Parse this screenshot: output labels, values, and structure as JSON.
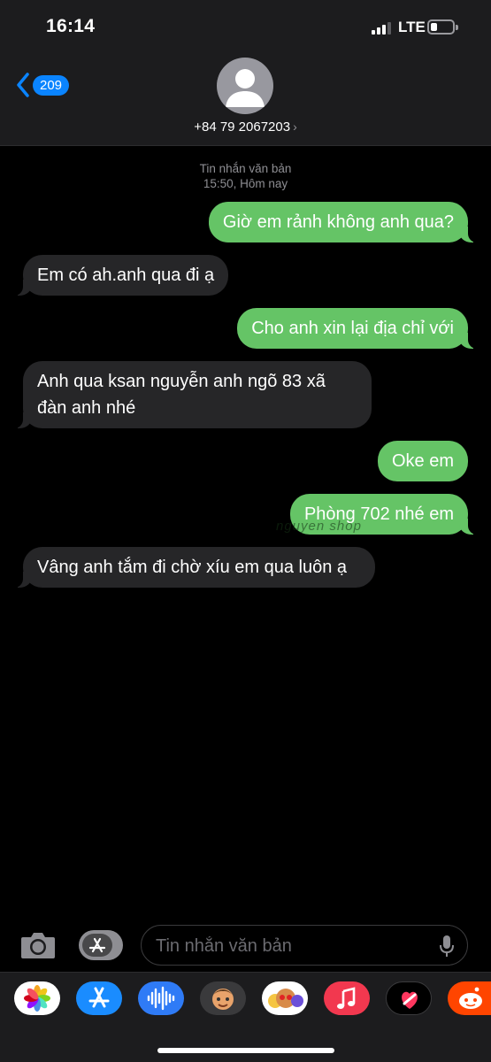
{
  "status_bar": {
    "time": "16:14",
    "network": "LTE"
  },
  "header": {
    "back_badge": "209",
    "contact_name": "+84 79 2067203",
    "contact_chevron": "›"
  },
  "thread": {
    "meta_line1": "Tin nhắn văn bản",
    "meta_line2": "15:50, Hôm nay",
    "messages": [
      {
        "direction": "outgoing",
        "text": "Giờ em rảnh không anh qua?"
      },
      {
        "direction": "incoming",
        "text": "Em có ah.anh qua đi ạ"
      },
      {
        "direction": "outgoing",
        "text": "Cho anh xin lại địa chỉ với"
      },
      {
        "direction": "incoming",
        "text": "Anh qua ksan nguyễn anh ngõ 83 xã đàn anh nhé"
      },
      {
        "direction": "outgoing",
        "text": "Oke em"
      },
      {
        "direction": "outgoing",
        "text": "Phòng 702 nhé em"
      },
      {
        "direction": "incoming",
        "text": "Vâng anh tắm đi chờ xíu em qua luôn ạ"
      }
    ],
    "watermark": "nguyen shop"
  },
  "compose": {
    "placeholder": "Tin nhắn văn bản"
  },
  "app_drawer": {
    "apps": [
      "photos-icon",
      "app-store-icon",
      "audio-message-icon",
      "memoji-icon",
      "animoji-stickers-icon",
      "music-icon",
      "digital-touch-icon",
      "reddit-icon"
    ]
  },
  "colors": {
    "outgoing_bubble": "#65c466",
    "incoming_bubble": "#262628",
    "accent": "#0a84ff",
    "background": "#000000",
    "header_bg": "#1c1c1e"
  }
}
